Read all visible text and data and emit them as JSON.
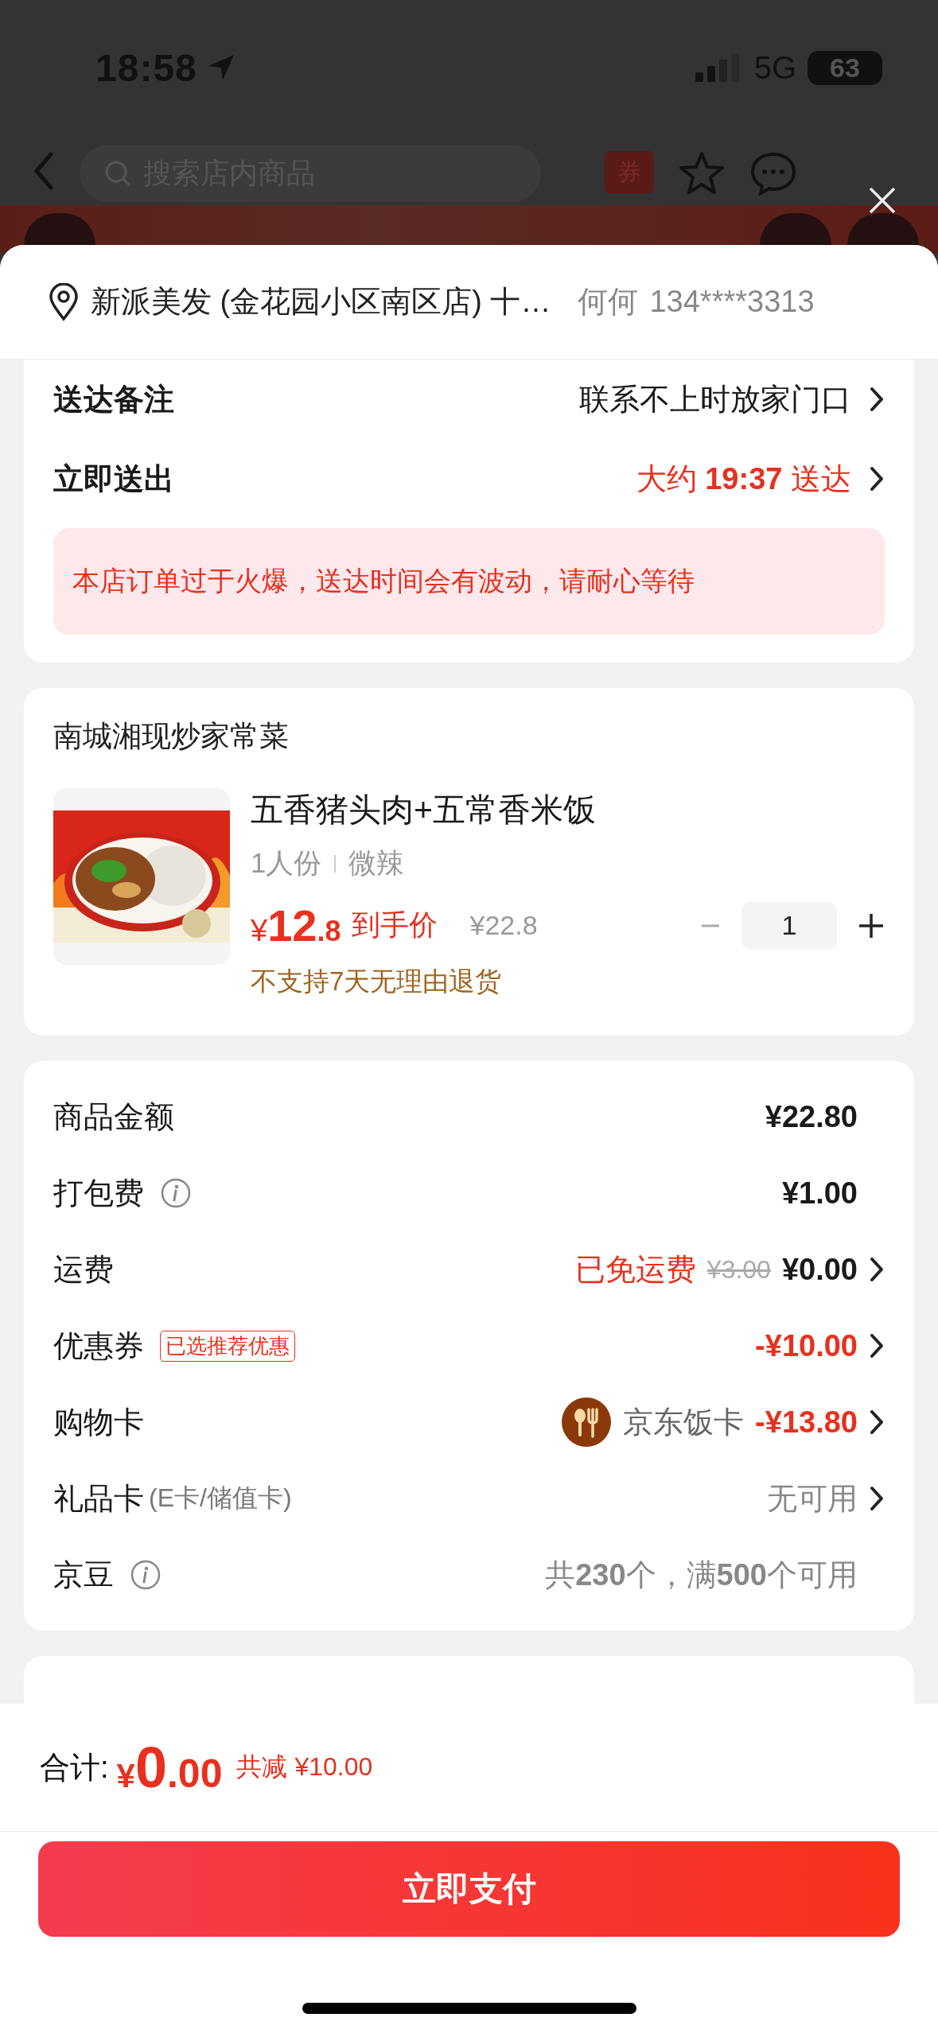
{
  "status_bar": {
    "time": "18:58",
    "network": "5G",
    "battery": "63"
  },
  "header": {
    "search": {
      "placeholder": "搜索店内商品"
    },
    "coupon_badge": "券"
  },
  "address": {
    "text": "新派美发 (金花园小区南区店) 十…",
    "name": "何何",
    "phone": "134****3313"
  },
  "delivery": {
    "rows": [
      {
        "label": "送达备注",
        "value": "联系不上时放家门口",
        "kind": "plain"
      },
      {
        "label": "立即送出",
        "value": "大约 **19:37** 送达",
        "kind": "highlight"
      }
    ],
    "notice": "本店订单过于火爆，送达时间会有波动，请耐心等待"
  },
  "store": {
    "name": "南城湘现炒家常菜",
    "items": [
      {
        "kind": "picture",
        "title": "五香猪头肉+五常香米饭",
        "specs": [
          "1人份",
          "微辣"
        ],
        "price": {
          "symbol": "¥",
          "integer": "12",
          "decimal": ".8"
        },
        "price_label": "到手价",
        "original_price": "¥22.8",
        "quantity": "1",
        "decrease_disabled": true,
        "note": "不支持7天无理由退货"
      }
    ]
  },
  "fees": [
    {
      "label": "商品金额",
      "info": false,
      "value": "¥22.80",
      "color": "#1a1a1a",
      "bold": true,
      "chevron": false
    },
    {
      "label": "打包费",
      "info": true,
      "value": "¥1.00",
      "color": "#1a1a1a",
      "bold": true,
      "chevron": false
    },
    {
      "label": "运费",
      "info": false,
      "note": "已免运费",
      "strike": "¥3.00",
      "value": "¥0.00",
      "color": "#1a1a1a",
      "bold": true,
      "chevron": true
    },
    {
      "label": "优惠券",
      "info": false,
      "tag": "已选推荐优惠",
      "value": "-¥10.00",
      "color": "#e8301e",
      "bold": true,
      "chevron": true
    },
    {
      "label": "购物卡",
      "info": false,
      "card_name": "京东饭卡",
      "value": "-¥13.80",
      "color": "#e8301e",
      "bold": true,
      "chevron": true
    },
    {
      "label": "礼品卡",
      "info": false,
      "sublabel": "(E卡/储值卡)",
      "value": "无可用",
      "color": "#888888",
      "bold": false,
      "chevron": true
    },
    {
      "label": "京豆",
      "info": true,
      "value": "共**230**个，满**500**个可用",
      "color": "#888888",
      "bold": false,
      "chevron": false
    }
  ],
  "footer": {
    "total_label": "合计:",
    "total": {
      "symbol": "¥",
      "integer": "0",
      "decimal": ".00"
    },
    "savings": "共减 ¥10.00",
    "pay_button": "立即支付"
  }
}
